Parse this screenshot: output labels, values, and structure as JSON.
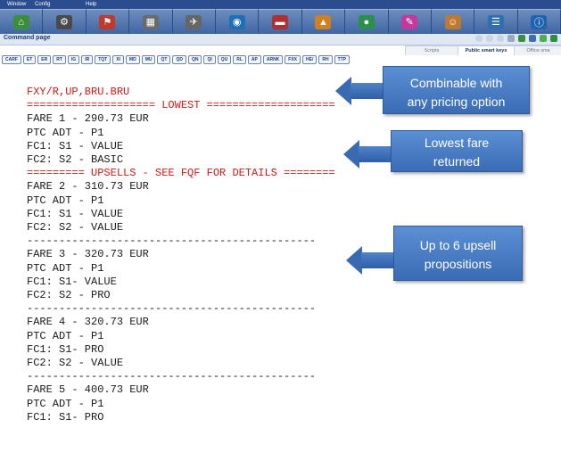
{
  "menubar": {
    "window": "Window",
    "config": "Config",
    "help": "Help"
  },
  "toolbar": {
    "icons": [
      {
        "name": "home-icon",
        "glyph": "⌂",
        "color": "#3c8d3c"
      },
      {
        "name": "gear-icon",
        "glyph": "⚙",
        "color": "#4a4a4a"
      },
      {
        "name": "flag-icon",
        "glyph": "⚑",
        "color": "#c0392b"
      },
      {
        "name": "calendar-icon",
        "glyph": "▦",
        "color": "#6a6a6a"
      },
      {
        "name": "airplane-icon",
        "glyph": "✈",
        "color": "#666"
      },
      {
        "name": "car-icon",
        "glyph": "◉",
        "color": "#1e6fb5"
      },
      {
        "name": "hotel-icon",
        "glyph": "▬",
        "color": "#b03030"
      },
      {
        "name": "train-icon",
        "glyph": "▲",
        "color": "#d08020"
      },
      {
        "name": "globe-icon",
        "glyph": "●",
        "color": "#2c8f4c"
      },
      {
        "name": "pen-icon",
        "glyph": "✎",
        "color": "#c23b9a"
      },
      {
        "name": "person-icon",
        "glyph": "☺",
        "color": "#c07a30"
      },
      {
        "name": "document-icon",
        "glyph": "☰",
        "color": "#2f6fb0"
      },
      {
        "name": "info-icon",
        "glyph": "ⓘ",
        "color": "#1f64b0"
      }
    ]
  },
  "command_page": {
    "title": "Command page"
  },
  "tabs": {
    "scripts": "Scripts",
    "smart_keys": "Public smart keys",
    "office": "Office sma"
  },
  "smart_keys": [
    "CARF",
    "ET",
    "ER",
    "RT",
    "IG",
    "IR",
    "TQT",
    "XI",
    "MD",
    "MU",
    "QT",
    "QD",
    "QN",
    "QI",
    "QU",
    "RL",
    "AP",
    "ARNK",
    "FXX",
    "HE/",
    "RH",
    "TTP"
  ],
  "terminal": {
    "line01": "FXY/R,UP,BRU.BRU",
    "line02": "==================== LOWEST ====================",
    "line03": "FARE 1 - 290.73 EUR",
    "line04": "PTC ADT - P1",
    "line05": "FC1: S1 - VALUE",
    "line06": "FC2: S2 - BASIC",
    "line07": "========= UPSELLS - SEE FQF FOR DETAILS ========",
    "line08": "FARE 2 - 310.73 EUR",
    "line09": "PTC ADT - P1",
    "line10": "FC1: S1 - VALUE",
    "line11": "FC2: S2 - VALUE",
    "line12": "---------------------------------------------",
    "line13": "FARE 3 - 320.73 EUR",
    "line14": "PTC ADT - P1",
    "line15": "FC1: S1- VALUE",
    "line16": "FC2: S2 - PRO",
    "line17": "---------------------------------------------",
    "line18": "FARE 4 - 320.73 EUR",
    "line19": "PTC ADT - P1",
    "line20": "FC1: S1- PRO",
    "line21": "FC2: S2 - VALUE",
    "line22": "---------------------------------------------",
    "line23": "FARE 5 - 400.73 EUR",
    "line24": "PTC ADT - P1",
    "line25": "FC1: S1- PRO"
  },
  "callouts": {
    "combinable": {
      "line1": "Combinable with",
      "line2": "any pricing option"
    },
    "lowest": {
      "line1": "Lowest fare",
      "line2": "returned"
    },
    "upsell": {
      "line1": "Up to 6 upsell",
      "line2": "propositions"
    }
  }
}
